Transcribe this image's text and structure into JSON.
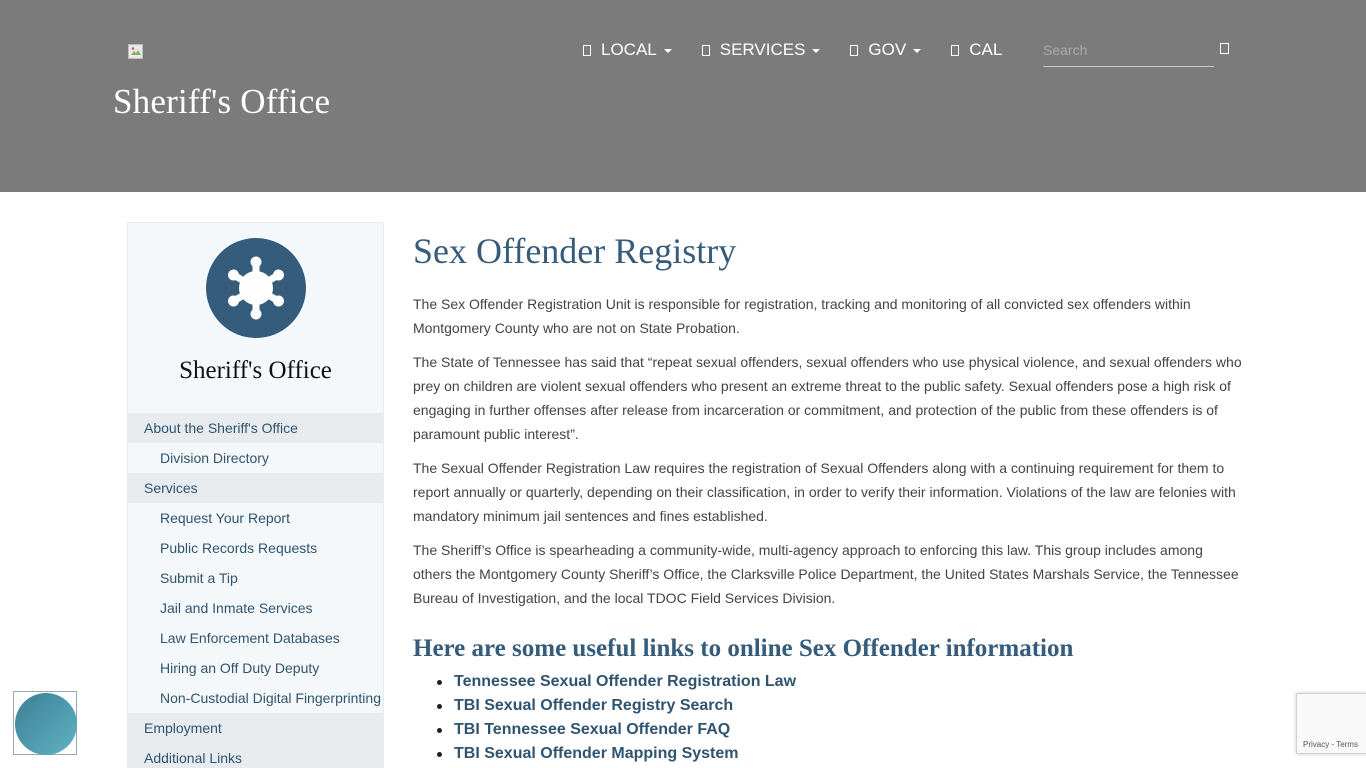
{
  "header": {
    "site_title": "Sheriff's Office",
    "nav": [
      {
        "label": "LOCAL",
        "has_dropdown": true
      },
      {
        "label": "SERVICES",
        "has_dropdown": true
      },
      {
        "label": "GOV",
        "has_dropdown": true
      },
      {
        "label": "CAL",
        "has_dropdown": false
      }
    ],
    "search": {
      "placeholder": "Search",
      "value": ""
    },
    "icons": {
      "logo": "broken-image-icon",
      "search": "search-icon",
      "nav_item": "glyph-placeholder-icon",
      "dropdown": "caret-down-icon"
    }
  },
  "sidebar": {
    "title": "Sheriff's Office",
    "badge_icon": "sheriff-star-icon",
    "items": [
      {
        "label": "About the Sheriff's Office",
        "level": 1
      },
      {
        "label": "Division Directory",
        "level": 2
      },
      {
        "label": "Services",
        "level": 1
      },
      {
        "label": "Request Your Report",
        "level": 2
      },
      {
        "label": "Public Records Requests",
        "level": 2
      },
      {
        "label": "Submit a Tip",
        "level": 2
      },
      {
        "label": "Jail and Inmate Services",
        "level": 2
      },
      {
        "label": "Law Enforcement Databases",
        "level": 2
      },
      {
        "label": "Hiring an Off Duty Deputy",
        "level": 2
      },
      {
        "label": "Non-Custodial Digital Fingerprinting",
        "level": 2
      },
      {
        "label": "Employment",
        "level": 1
      },
      {
        "label": "Additional Links",
        "level": 1
      }
    ]
  },
  "main": {
    "title": "Sex Offender Registry",
    "paragraphs": [
      "The Sex Offender Registration Unit is responsible for registration, tracking and monitoring of all convicted sex offenders within Montgomery County who are not on State Probation.",
      "The State of Tennessee has said that “repeat sexual offenders, sexual offenders who use physical violence, and sexual offenders who prey on children are violent sexual offenders who present an extreme threat to the public safety. Sexual offenders pose a high risk of engaging in further offenses after release from incarceration or commitment, and protection of the public from these offenders is of paramount public interest”.",
      "The Sexual Offender Registration Law requires the registration of Sexual Offenders along with a continuing requirement for them to report annually or quarterly, depending on their classification, in order to verify their information. Violations of the law are felonies with mandatory minimum jail sentences and fines established.",
      "The Sheriff’s Office is spearheading a community-wide, multi-agency approach to enforcing this law. This group includes among others the Montgomery County Sheriff’s Office, the Clarksville Police Department, the United States Marshals Service, the Tennessee Bureau of Investigation, and the local TDOC Field Services Division."
    ],
    "links_heading": "Here are some useful links to online Sex Offender information",
    "links": [
      "Tennessee Sexual Offender Registration Law",
      "TBI Sexual Offender Registry Search",
      "TBI Tennessee Sexual Offender FAQ",
      "TBI Sexual Offender Mapping System"
    ]
  },
  "widgets": {
    "accessibility_icon": "accessibility-icon",
    "recaptcha_links": "Privacy - Terms"
  },
  "colors": {
    "header_bg": "#7b7b7b",
    "accent": "#355c7a",
    "link": "#2f5470",
    "sidebar_bg": "#f5f8fa",
    "sidebar_section_bg": "#e8ebee"
  }
}
